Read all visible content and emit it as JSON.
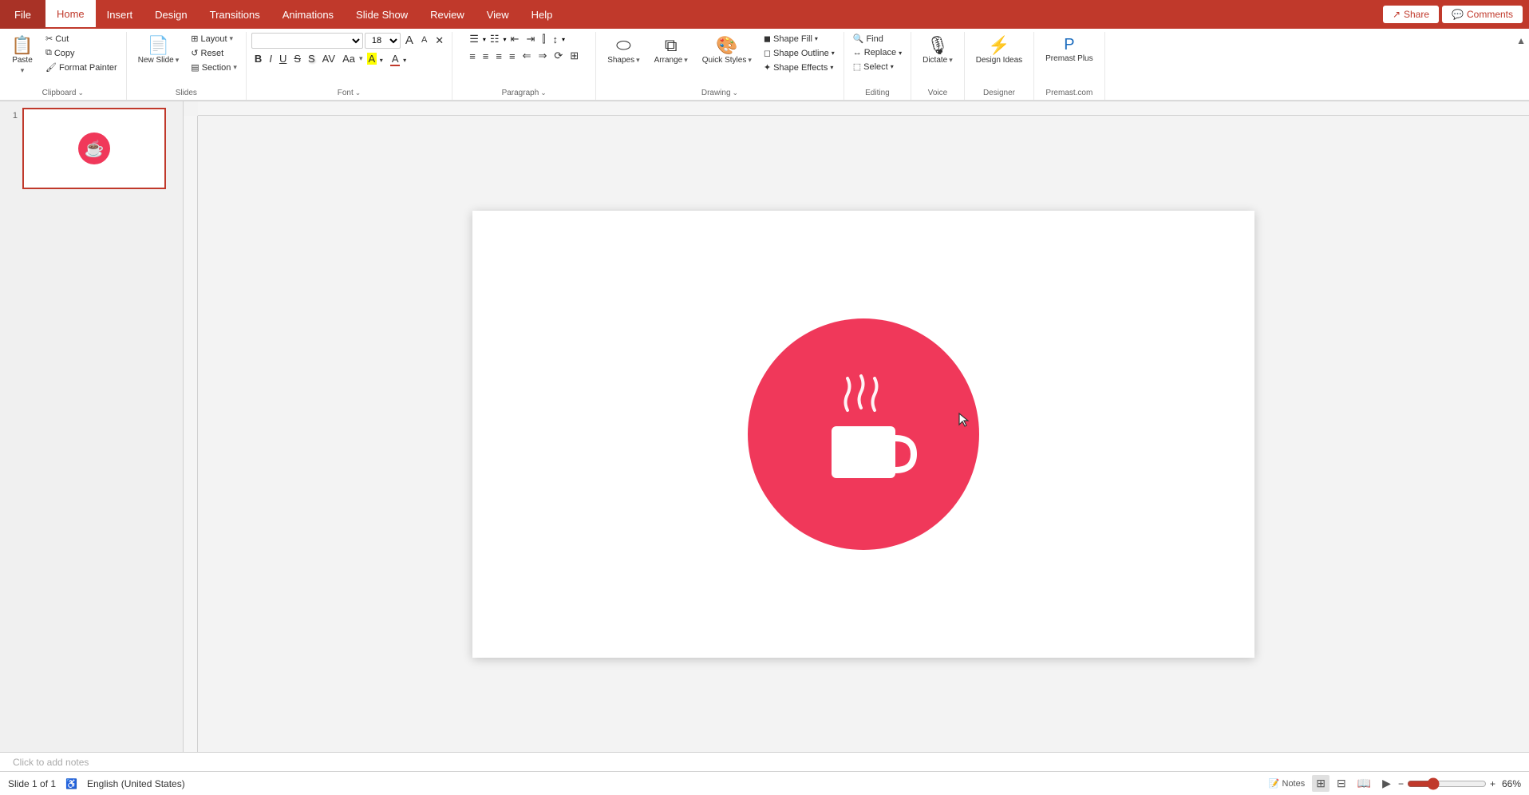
{
  "tabs": {
    "file": "File",
    "home": "Home",
    "insert": "Insert",
    "design": "Design",
    "transitions": "Transitions",
    "animations": "Animations",
    "slideshow": "Slide Show",
    "review": "Review",
    "view": "View",
    "help": "Help"
  },
  "title_right": {
    "share_label": "Share",
    "comments_label": "Comments"
  },
  "clipboard": {
    "paste_label": "Paste",
    "cut_label": "Cut",
    "copy_label": "Copy",
    "format_painter_label": "Format Painter",
    "group_label": "Clipboard",
    "expand_icon": "⌄"
  },
  "slides": {
    "layout_label": "Layout",
    "reset_label": "Reset",
    "new_slide_label": "New Slide",
    "section_label": "Section",
    "group_label": "Slides"
  },
  "font": {
    "font_name": "",
    "font_size": "18",
    "grow_label": "A",
    "shrink_label": "A",
    "clear_label": "✕",
    "bold_label": "B",
    "italic_label": "I",
    "underline_label": "U",
    "strikethrough_label": "S",
    "shadow_label": "S",
    "char_spacing_label": "AV",
    "change_case_label": "Aa",
    "font_color_label": "A",
    "highlight_label": "A",
    "group_label": "Font",
    "expand_icon": "⌄"
  },
  "paragraph": {
    "bullets_label": "Bullets",
    "numbering_label": "Numbering",
    "decrease_label": "◁",
    "increase_label": "▷",
    "columns_label": "☰",
    "line_spacing_label": "Line Spacing",
    "align_left_label": "≡",
    "align_center_label": "≡",
    "align_right_label": "≡",
    "justify_label": "≡",
    "rtl_label": "RTL",
    "ltr_label": "LTR",
    "add_col_label": "Col",
    "group_label": "Paragraph",
    "expand_icon": "⌄"
  },
  "drawing": {
    "shapes_label": "Shapes",
    "arrange_label": "Arrange",
    "quick_styles_label": "Quick Styles",
    "shape_fill_label": "Shape Fill",
    "shape_outline_label": "Shape Outline",
    "shape_effects_label": "Shape Effects",
    "group_label": "Drawing",
    "expand_icon": "⌄"
  },
  "editing": {
    "find_label": "Find",
    "replace_label": "Replace",
    "select_label": "Select",
    "group_label": "Editing"
  },
  "voice": {
    "dictate_label": "Dictate",
    "group_label": "Voice"
  },
  "designer": {
    "design_ideas_label": "Design Ideas",
    "group_label": "Designer"
  },
  "premast": {
    "premast_plus_label": "Premast Plus",
    "group_label": "Premast.com"
  },
  "status": {
    "slide_info": "Slide 1 of 1",
    "language": "English (United States)",
    "notes_label": "Notes",
    "zoom_level": "66%"
  },
  "slide": {
    "number": "1"
  }
}
